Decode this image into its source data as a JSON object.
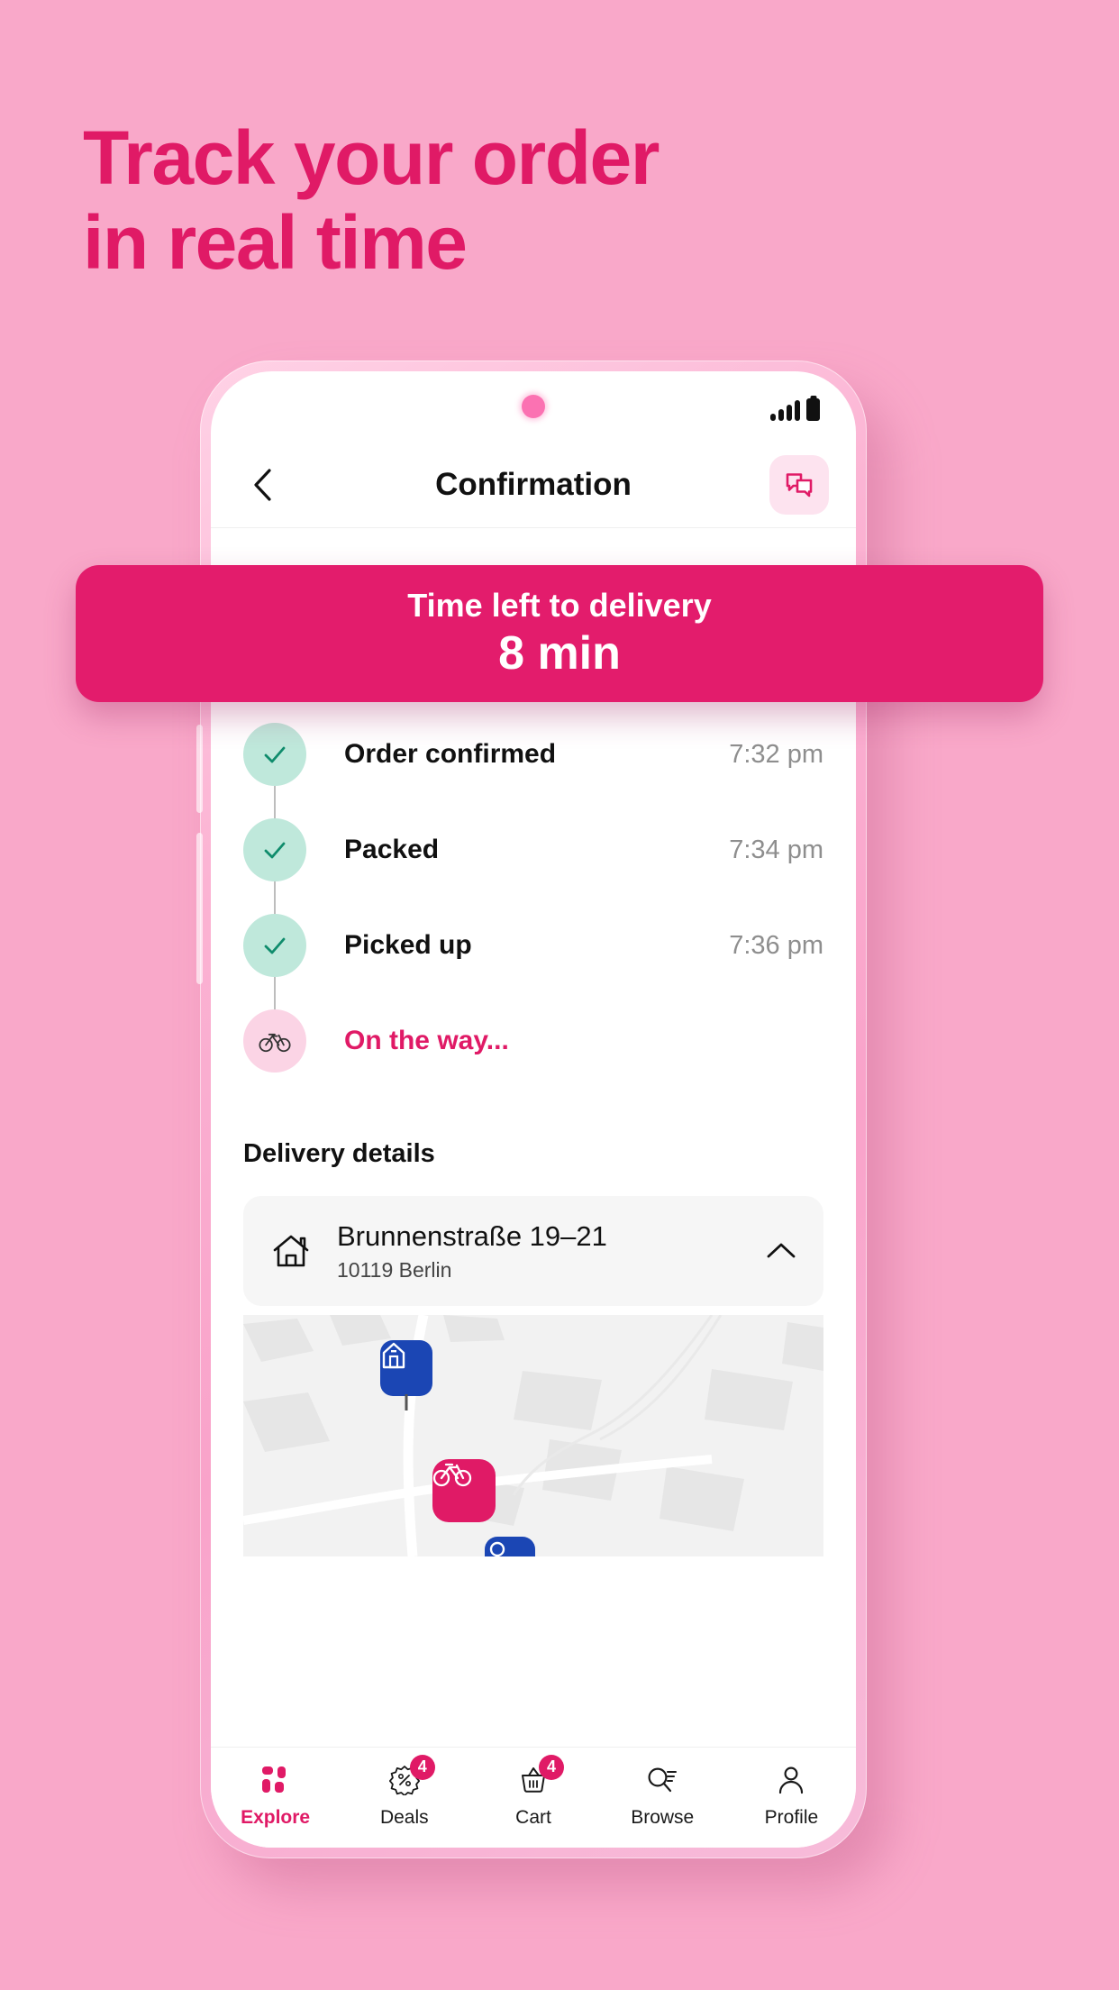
{
  "promo": {
    "headline_line1": "Track your order",
    "headline_line2": "in real time",
    "accent_color": "#E01A66",
    "background_color": "#F9A8C9"
  },
  "banner": {
    "subtitle": "Time left to delivery",
    "value": "8 min",
    "background_color": "#E31C6C"
  },
  "statusbar": {
    "signal_icon": "signal-bars-icon",
    "battery_icon": "battery-icon",
    "camera_icon": "front-camera-icon"
  },
  "appbar": {
    "back_icon": "chevron-left-icon",
    "title": "Confirmation",
    "chat_icon": "chat-bubbles-icon"
  },
  "timeline": {
    "steps": [
      {
        "label": "Order confirmed",
        "time": "7:32 pm",
        "state": "done",
        "icon": "check-icon"
      },
      {
        "label": "Packed",
        "time": "7:34 pm",
        "state": "done",
        "icon": "check-icon"
      },
      {
        "label": "Picked up",
        "time": "7:36 pm",
        "state": "done",
        "icon": "check-icon"
      },
      {
        "label": "On the way...",
        "time": "",
        "state": "active",
        "icon": "bicycle-icon"
      }
    ]
  },
  "delivery": {
    "section_title": "Delivery details",
    "home_icon": "house-icon",
    "address_line1": "Brunnenstraße 19–21",
    "address_line2": "10119 Berlin",
    "collapse_icon": "chevron-up-icon"
  },
  "map": {
    "home_marker_icon": "house-marker-icon",
    "courier_marker_icon": "bicycle-marker-icon",
    "store_marker_icon": "store-marker-icon",
    "courier_marker_color": "#E01A66",
    "home_marker_color": "#1B46B4"
  },
  "bottomnav": {
    "items": [
      {
        "label": "Explore",
        "icon": "grid-squares-icon",
        "active": true,
        "badge": ""
      },
      {
        "label": "Deals",
        "icon": "deal-tag-icon",
        "active": false,
        "badge": "4"
      },
      {
        "label": "Cart",
        "icon": "basket-icon",
        "active": false,
        "badge": "4"
      },
      {
        "label": "Browse",
        "icon": "search-list-icon",
        "active": false,
        "badge": ""
      },
      {
        "label": "Profile",
        "icon": "person-icon",
        "active": false,
        "badge": ""
      }
    ]
  }
}
